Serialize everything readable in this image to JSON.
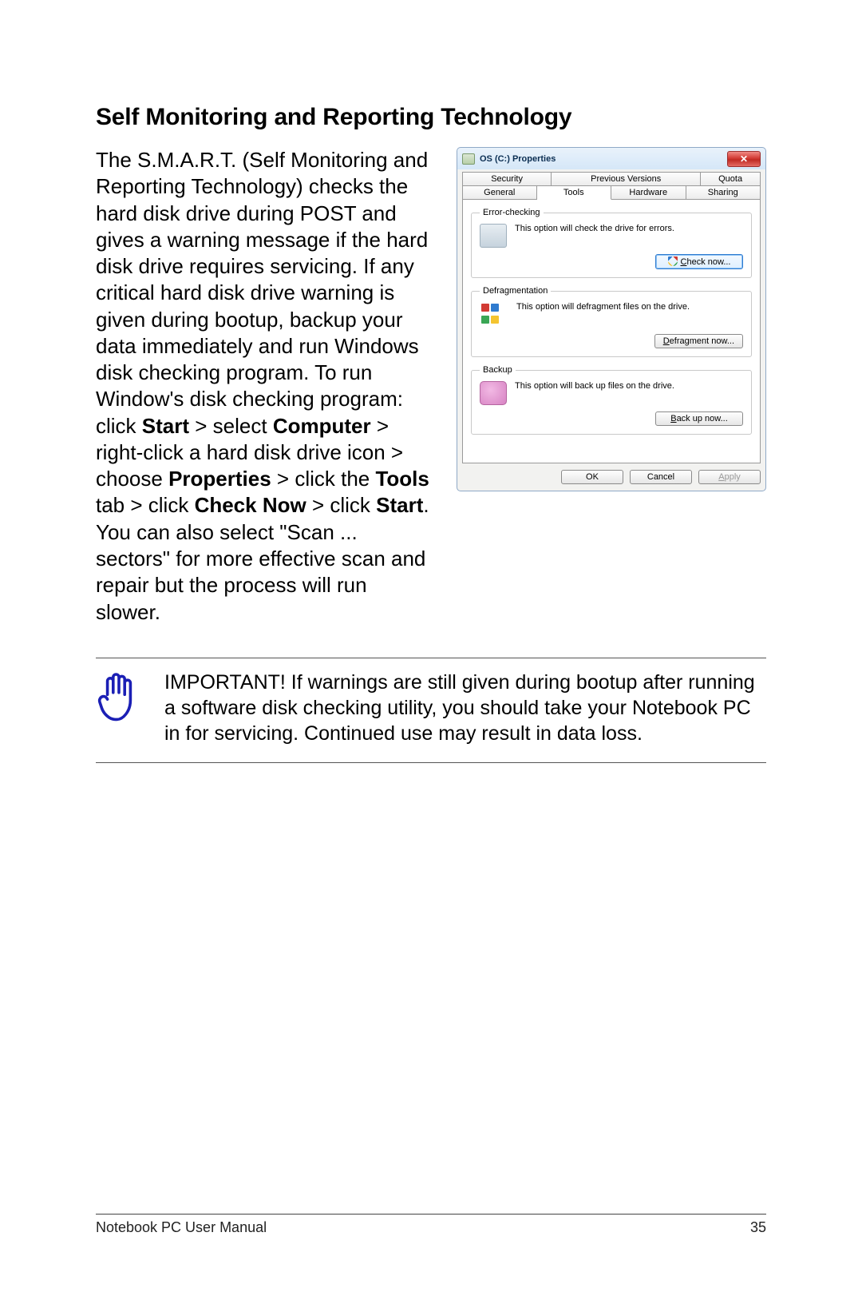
{
  "heading": "Self Monitoring and Reporting Technology",
  "body": {
    "p1a": "The S.M.A.R.T. (Self Monitoring and Reporting Technology) checks the hard disk drive during POST and gives a warning message if the hard disk drive requires servicing. If any critical hard disk drive warning is given during bootup, backup your data immediately and run Windows disk checking program. To run Window's disk checking program: click ",
    "b1": "Start",
    "p1b": " > select ",
    "b2": "Computer",
    "p1c": " > right-click a hard disk drive icon > choose ",
    "b3": "Properties",
    "p1d": " > click the ",
    "b4": "Tools",
    "p1e": " tab > click ",
    "b5": "Check Now",
    "p1f": " > click ",
    "b6": "Start",
    "p1g": ". You can also select \"Scan ... sectors\" for more effective scan and repair but the process will run slower."
  },
  "dialog": {
    "title": "OS (C:) Properties",
    "tabs_row1": {
      "security": "Security",
      "previous": "Previous Versions",
      "quota": "Quota"
    },
    "tabs_row2": {
      "general": "General",
      "tools": "Tools",
      "hardware": "Hardware",
      "sharing": "Sharing"
    },
    "groups": {
      "error": {
        "legend": "Error-checking",
        "text": "This option will check the drive for errors.",
        "button_u": "C",
        "button_rest": "heck now..."
      },
      "defrag": {
        "legend": "Defragmentation",
        "text": "This option will defragment files on the drive.",
        "button_u": "D",
        "button_rest": "efragment now..."
      },
      "backup": {
        "legend": "Backup",
        "text": "This option will back up files on the drive.",
        "button_u": "B",
        "button_rest": "ack up now..."
      }
    },
    "actions": {
      "ok": "OK",
      "cancel": "Cancel",
      "apply_u": "A",
      "apply_rest": "pply"
    }
  },
  "note": "IMPORTANT! If warnings are still given during bootup after running a software disk checking utility, you should take your Notebook PC in for servicing. Continued use may result in data loss.",
  "footer": {
    "left": "Notebook PC User Manual",
    "right": "35"
  }
}
